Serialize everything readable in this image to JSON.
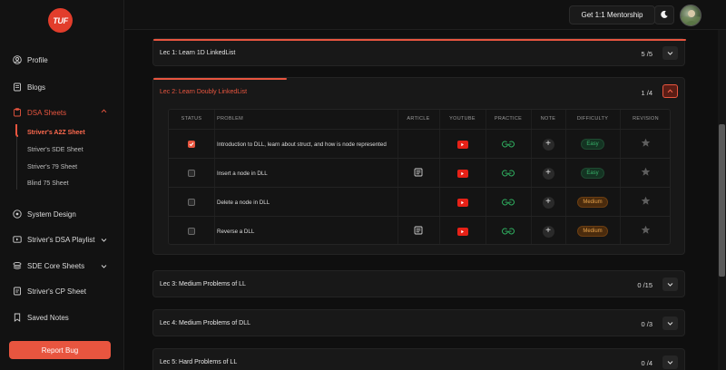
{
  "brand": {
    "logo_text": "TUF"
  },
  "header": {
    "mentorship_label": "Get 1:1 Mentorship"
  },
  "sidebar": {
    "items": [
      {
        "label": "Profile"
      },
      {
        "label": "Blogs"
      },
      {
        "label": "DSA Sheets"
      },
      {
        "label": "System Design"
      },
      {
        "label": "Striver's DSA Playlist"
      },
      {
        "label": "SDE Core Sheets"
      },
      {
        "label": "Striver's CP Sheet"
      },
      {
        "label": "Saved Notes"
      }
    ],
    "sheets": [
      {
        "label": "Striver's A2Z Sheet"
      },
      {
        "label": "Striver's SDE Sheet"
      },
      {
        "label": "Striver's 79 Sheet"
      },
      {
        "label": "Blind 75 Sheet"
      }
    ],
    "report_label": "Report Bug"
  },
  "lectures": [
    {
      "title": "Lec 1: Learn 1D LinkedList",
      "count": "5 /5"
    },
    {
      "title": "Lec 2: Learn Doubly LinkedList",
      "count": "1 /4"
    },
    {
      "title": "Lec 3: Medium Problems of LL",
      "count": "0 /15"
    },
    {
      "title": "Lec 4: Medium Problems of DLL",
      "count": "0 /3"
    },
    {
      "title": "Lec 5: Hard Problems of LL",
      "count": "0 /4"
    }
  ],
  "table": {
    "headers": {
      "status": "STATUS",
      "problem": "PROBLEM",
      "article": "ARTICLE",
      "youtube": "YOUTUBE",
      "practice": "PRACTICE",
      "note": "NOTE",
      "difficulty": "DIFFICULTY",
      "revision": "REVISION"
    },
    "rows": [
      {
        "problem": "Introduction to DLL, learn about struct, and how is node represented",
        "done": true,
        "has_article": false,
        "difficulty": "Easy"
      },
      {
        "problem": "Insert a node in DLL",
        "done": false,
        "has_article": true,
        "difficulty": "Easy"
      },
      {
        "problem": "Delete a node in DLL",
        "done": false,
        "has_article": false,
        "difficulty": "Medium"
      },
      {
        "problem": "Reverse a DLL",
        "done": false,
        "has_article": true,
        "difficulty": "Medium"
      }
    ]
  },
  "colors": {
    "accent": "#e8553f",
    "easy": "#38b06a",
    "medium": "#e6a24a",
    "practice": "#2fae5f"
  }
}
